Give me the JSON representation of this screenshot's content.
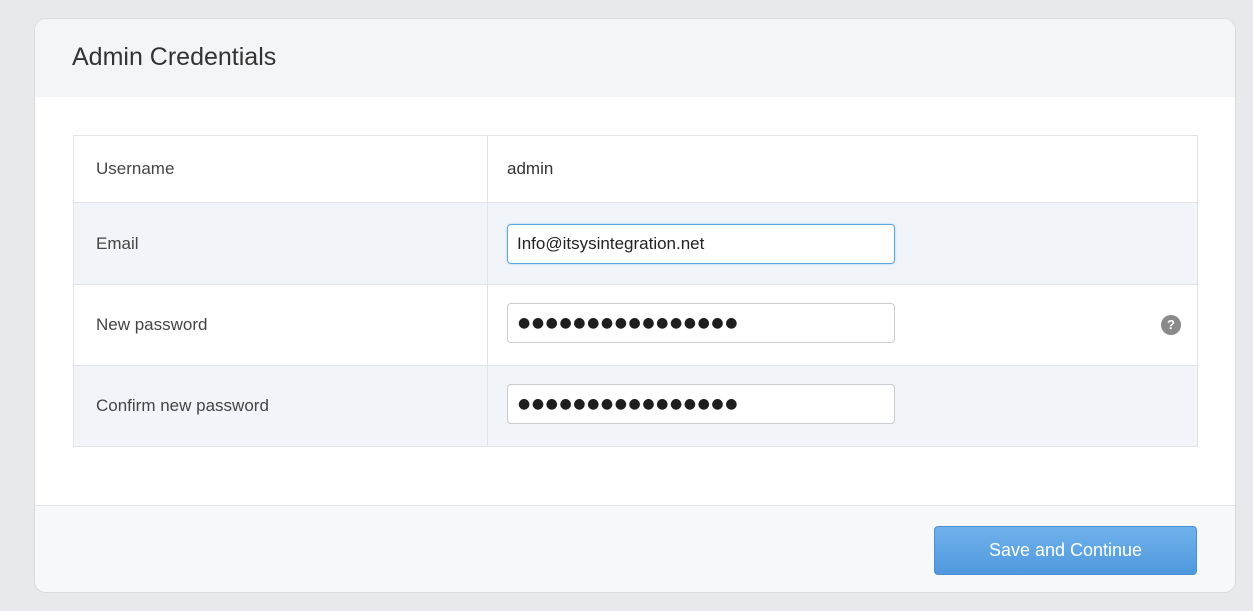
{
  "panel": {
    "title": "Admin Credentials"
  },
  "form": {
    "username": {
      "label": "Username",
      "value": "admin"
    },
    "email": {
      "label": "Email",
      "value": "Info@itsysintegration.net"
    },
    "new_password": {
      "label": "New password",
      "masked_value": "●●●●●●●●●●●●●●●●",
      "help_icon": "question-circle-icon"
    },
    "confirm_password": {
      "label": "Confirm new password",
      "masked_value": "●●●●●●●●●●●●●●●●"
    }
  },
  "footer": {
    "save_label": "Save and Continue"
  },
  "colors": {
    "accent": "#5ea5dc",
    "button": "#5aa0e2",
    "row_alt": "#f1f5f9"
  }
}
